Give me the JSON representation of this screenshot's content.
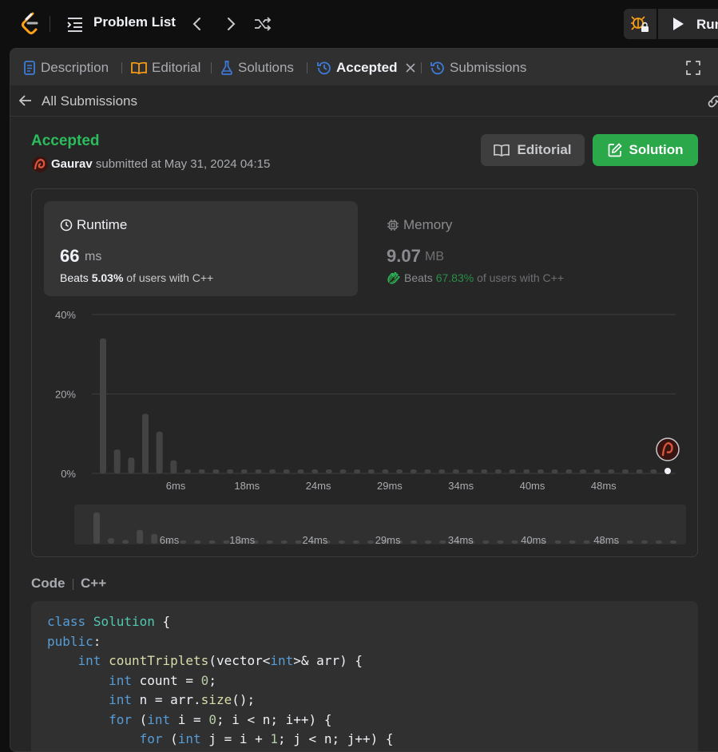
{
  "topbar": {
    "title": "Problem List",
    "run_label": "Run"
  },
  "tabs": [
    {
      "label": "Description",
      "icon": "description-icon",
      "active": false
    },
    {
      "label": "Editorial",
      "icon": "book-icon",
      "active": false
    },
    {
      "label": "Solutions",
      "icon": "flask-icon",
      "active": false
    },
    {
      "label": "Accepted",
      "icon": "history-icon",
      "active": true
    },
    {
      "label": "Submissions",
      "icon": "history-icon",
      "active": false
    }
  ],
  "subbar": {
    "back_label": "All Submissions"
  },
  "submission": {
    "status": "Accepted",
    "user": "Gaurav",
    "submitted_text": "submitted at May 31, 2024 04:15"
  },
  "buttons": {
    "editorial": "Editorial",
    "solution": "Solution"
  },
  "runtime": {
    "label": "Runtime",
    "value": "66",
    "unit": "ms",
    "beats_prefix": "Beats",
    "beats_value": "5.03%",
    "beats_suffix": "of users with C++"
  },
  "memory": {
    "label": "Memory",
    "value": "9.07",
    "unit": "MB",
    "beats_prefix": "Beats",
    "beats_value": "67.83%",
    "beats_suffix": "of users with C++"
  },
  "chart_data": {
    "type": "bar",
    "title": "",
    "xlabel": "",
    "ylabel": "",
    "y_ticks": [
      "40%",
      "20%",
      "0%"
    ],
    "ylim": [
      0,
      40
    ],
    "grid": true,
    "x_tick_labels": [
      "6ms",
      "18ms",
      "24ms",
      "29ms",
      "34ms",
      "40ms",
      "48ms"
    ],
    "values": [
      34,
      6,
      4,
      15,
      10.5,
      3.3,
      1,
      1,
      1,
      1,
      1,
      1,
      1,
      1,
      1,
      1,
      1,
      1,
      1,
      1,
      1,
      1,
      1,
      1,
      1,
      1,
      1,
      1,
      1,
      1,
      1,
      1,
      1,
      1,
      1,
      1,
      1,
      1,
      1,
      1,
      1
    ],
    "highlight_index": 40,
    "colors": {
      "bar": "#434343",
      "highlight": "#eff1f6",
      "grid": "#3d3d3d"
    }
  },
  "code": {
    "label": "Code",
    "language": "C++"
  },
  "colors": {
    "accent_green": "#2cbb5d",
    "button_green": "#2ba84a",
    "panel": "#262626"
  }
}
